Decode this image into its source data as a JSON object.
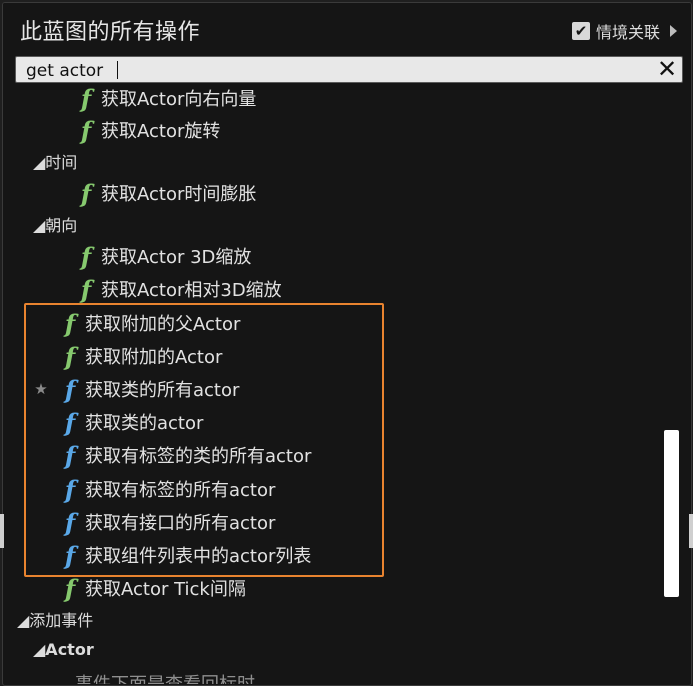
{
  "header": {
    "title": "此蓝图的所有操作",
    "context_sensitive_label": "情境关联",
    "context_sensitive_checked": "✔"
  },
  "search": {
    "value": "get actor",
    "clear_glyph": "✕"
  },
  "list": {
    "items_top": [
      {
        "icon": "function-icon-green",
        "label": "获取Actor向右向量"
      },
      {
        "icon": "function-icon-green",
        "label": "获取Actor旋转"
      }
    ],
    "cat_time": "◢时间",
    "items_time": [
      {
        "icon": "function-icon-green",
        "label": "获取Actor时间膨胀"
      }
    ],
    "cat_orientation": "◢朝向",
    "items_orientation": [
      {
        "icon": "function-icon-green",
        "label": "获取Actor 3D缩放"
      },
      {
        "icon": "function-icon-green",
        "label": "获取Actor相对3D缩放"
      }
    ],
    "items_main": [
      {
        "icon": "function-icon-green",
        "label": "获取附加的父Actor"
      },
      {
        "icon": "function-icon-green",
        "label": "获取附加的Actor"
      },
      {
        "icon": "function-icon-blue",
        "label": "获取类的所有actor",
        "favorite": "★"
      },
      {
        "icon": "function-icon-blue",
        "label": "获取类的actor"
      },
      {
        "icon": "function-icon-blue",
        "label": "获取有标签的类的所有actor"
      },
      {
        "icon": "function-icon-blue",
        "label": "获取有标签的所有actor"
      },
      {
        "icon": "function-icon-blue",
        "label": "获取有接口的所有actor"
      },
      {
        "icon": "function-icon-blue",
        "label": "获取组件列表中的actor列表"
      },
      {
        "icon": "function-icon-green",
        "label": "获取Actor Tick间隔"
      }
    ],
    "cat_add_event": "◢添加事件",
    "cat_actor": "◢Actor",
    "partial_item": "事件下面是查看回标时"
  },
  "colors": {
    "highlight_border": "#e8832f",
    "function_green": "#86c96e",
    "function_blue": "#5aa8e8"
  }
}
